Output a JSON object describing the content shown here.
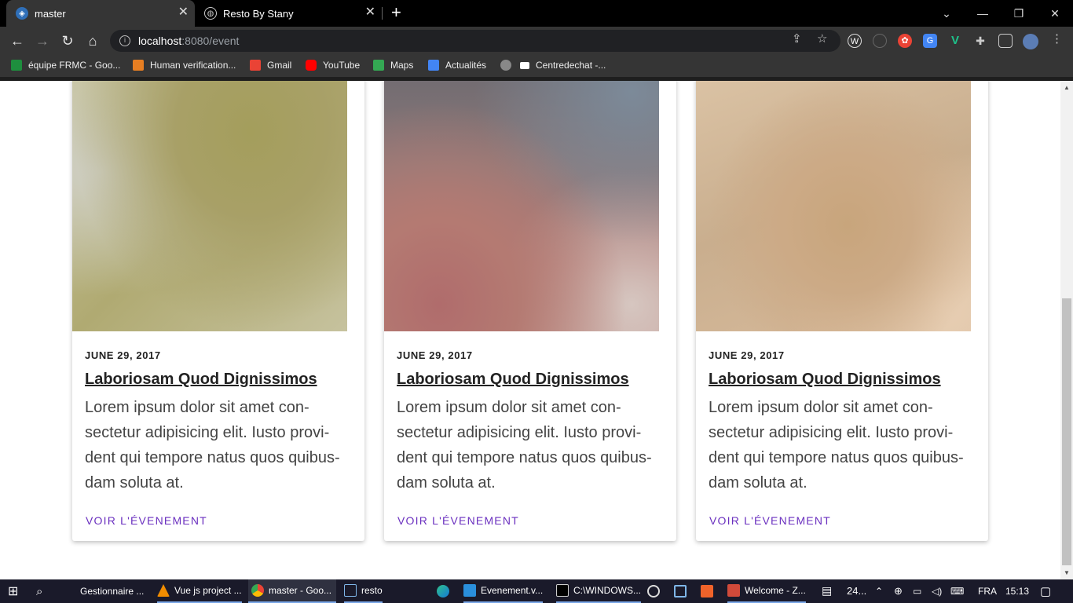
{
  "browser": {
    "tabs": [
      {
        "title": "master",
        "active": true
      },
      {
        "title": "Resto By Stany",
        "active": false
      }
    ],
    "address": {
      "host": "localhost",
      "path": ":8080/event"
    },
    "bookmarks": [
      {
        "label": "équipe FRMC - Goo...",
        "color": "#1e8e3e"
      },
      {
        "label": "Human verification...",
        "color": "#e67e22"
      },
      {
        "label": "Gmail",
        "color": "#ea4335"
      },
      {
        "label": "YouTube",
        "color": "#ff0000"
      },
      {
        "label": "Maps",
        "color": "#34a853"
      },
      {
        "label": "Actualités",
        "color": "#4285f4"
      },
      {
        "label": "Centredechat -...",
        "color": "#ffffff"
      }
    ]
  },
  "events": [
    {
      "date": "JUNE 29, 2017",
      "title": "Laboriosam Quod Dignissimos",
      "desc_lines": [
        "Lorem ipsum dolor sit amet con-",
        "sectetur adipisicing elit. Iusto provi-",
        "dent qui tempore natus quos quibus-",
        "dam soluta at."
      ],
      "link": "VOIR L'ÉVENEMENT"
    },
    {
      "date": "JUNE 29, 2017",
      "title": "Laboriosam Quod Dignissimos",
      "desc_lines": [
        "Lorem ipsum dolor sit amet con-",
        "sectetur adipisicing elit. Iusto provi-",
        "dent qui tempore natus quos quibus-",
        "dam soluta at."
      ],
      "link": "VOIR L'ÉVENEMENT"
    },
    {
      "date": "JUNE 29, 2017",
      "title": "Laboriosam Quod Dignissimos",
      "desc_lines": [
        "Lorem ipsum dolor sit amet con-",
        "sectetur adipisicing elit. Iusto provi-",
        "dent qui tempore natus quos quibus-",
        "dam soluta at."
      ],
      "link": "VOIR L'ÉVENEMENT"
    }
  ],
  "taskbar": {
    "apps": [
      {
        "label": "Gestionnaire ..."
      },
      {
        "label": "Vue js project ..."
      },
      {
        "label": "master - Goo..."
      },
      {
        "label": "resto"
      },
      {
        "label": "Evenement.v..."
      },
      {
        "label": "C:\\WINDOWS..."
      },
      {
        "label": "Welcome - Z..."
      }
    ],
    "tray_text": "24...",
    "lang": "FRA",
    "time": "15:13"
  },
  "colors": {
    "link": "#6a2fbf",
    "chrome_bg": "#353535",
    "tabbar_bg": "#000000"
  }
}
